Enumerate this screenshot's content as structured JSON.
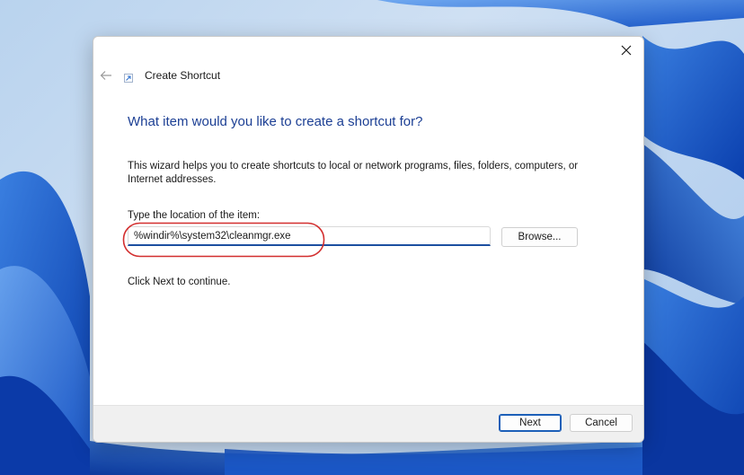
{
  "window": {
    "title": "Create Shortcut",
    "close_icon": "close-icon",
    "back_icon": "back-arrow-icon",
    "app_icon": "shortcut-icon"
  },
  "wizard": {
    "heading": "What item would you like to create a shortcut for?",
    "description": "This wizard helps you to create shortcuts to local or network programs, files, folders, computers, or Internet addresses.",
    "location_label": "Type the location of the item:",
    "location_value": "%windir%\\system32\\cleanmgr.exe",
    "browse_label": "Browse...",
    "continue_hint": "Click Next to continue."
  },
  "footer": {
    "next_label": "Next",
    "cancel_label": "Cancel"
  },
  "colors": {
    "heading": "#1c3f94",
    "accent": "#1c5fb8",
    "highlight_ring": "#d32f2f"
  }
}
